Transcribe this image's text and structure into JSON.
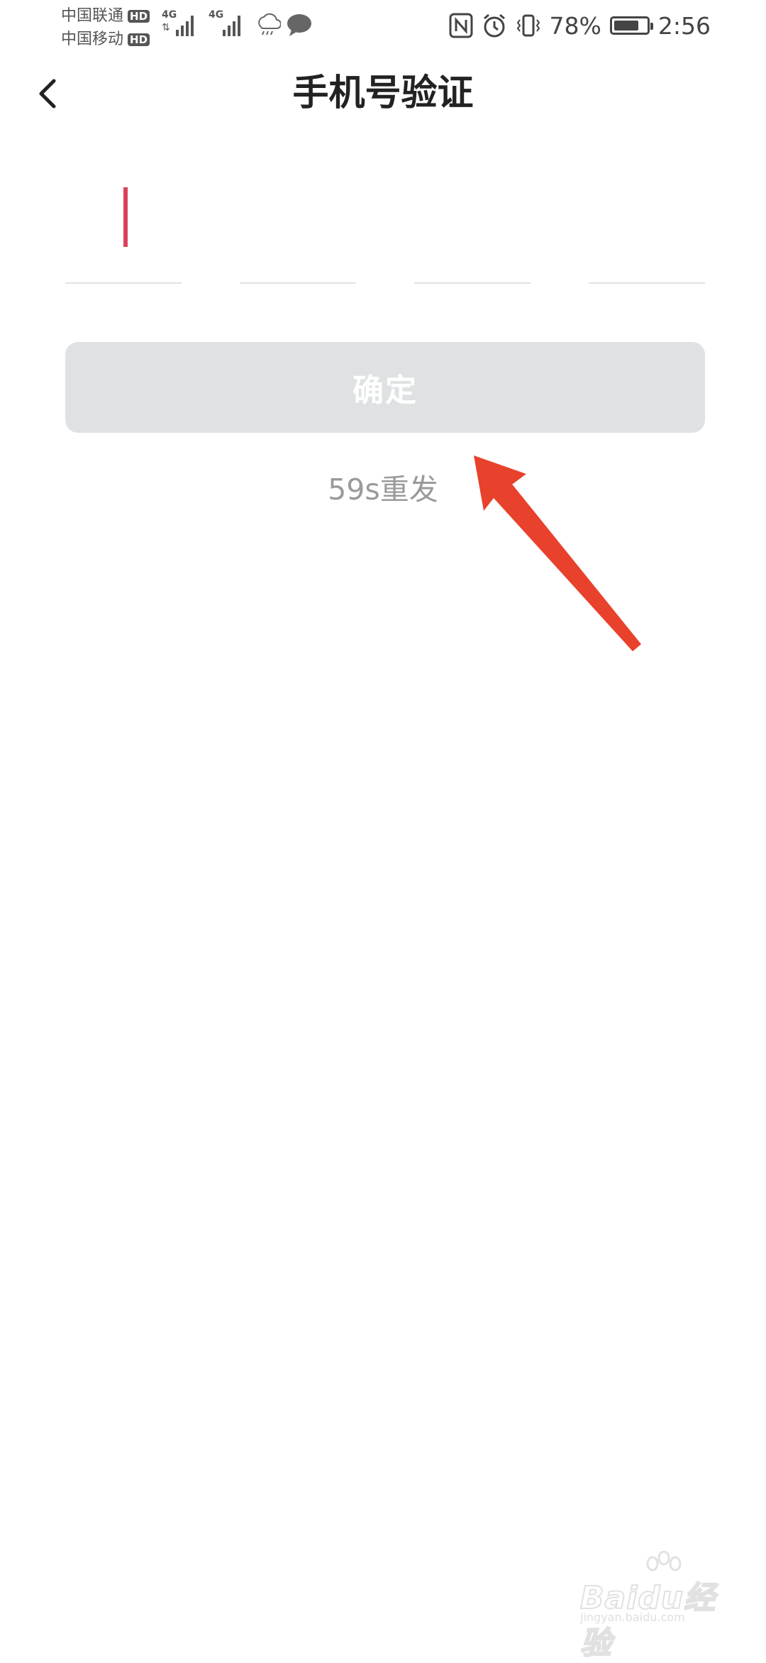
{
  "status_bar": {
    "carrier_1": "中国联通",
    "carrier_2": "中国移动",
    "hd_label": "HD",
    "network_label": "4G",
    "battery_percent": "78%",
    "battery_level": 0.78,
    "time": "2:56",
    "icons": [
      "signal-icon",
      "weather-icon",
      "message-icon",
      "nfc-icon",
      "alarm-icon",
      "vibrate-icon",
      "battery-icon"
    ]
  },
  "header": {
    "title": "手机号验证",
    "back_icon": "chevron-left-icon"
  },
  "code_input": {
    "digits": [
      "",
      "",
      "",
      ""
    ],
    "caret_color": "#d9435a"
  },
  "confirm": {
    "label": "确定",
    "disabled": true,
    "bg_color": "#dfe2e3"
  },
  "resend": {
    "label": "59s重发"
  },
  "annotation": {
    "arrow_color": "#e8412c"
  },
  "watermark": {
    "brand": "Baidu经验",
    "domain": "jingyan.baidu.com"
  }
}
